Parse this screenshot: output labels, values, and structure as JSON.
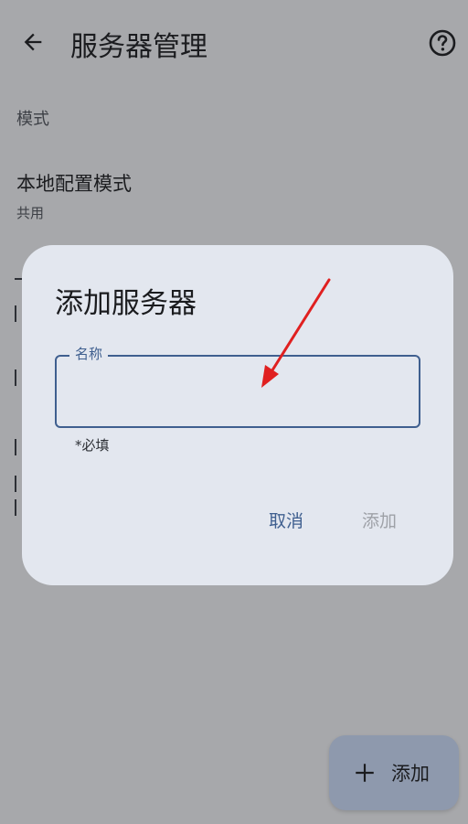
{
  "appbar": {
    "title": "服务器管理",
    "back_icon": "arrow-back-icon",
    "help_icon": "help-circle-icon"
  },
  "settings": {
    "section_header": "模式",
    "mode": {
      "title": "本地配置模式",
      "value": "共用"
    }
  },
  "dialog": {
    "title": "添加服务器",
    "field": {
      "label": "名称",
      "value": "",
      "helper": "*必填"
    },
    "cancel_label": "取消",
    "add_label": "添加"
  },
  "fab": {
    "label": "添加",
    "icon": "plus-icon"
  },
  "colors": {
    "accent": "#3f5f8f",
    "annotation_arrow": "#e02020",
    "dialog_bg": "#e3e7ef",
    "fab_bg": "#8e99ad"
  }
}
